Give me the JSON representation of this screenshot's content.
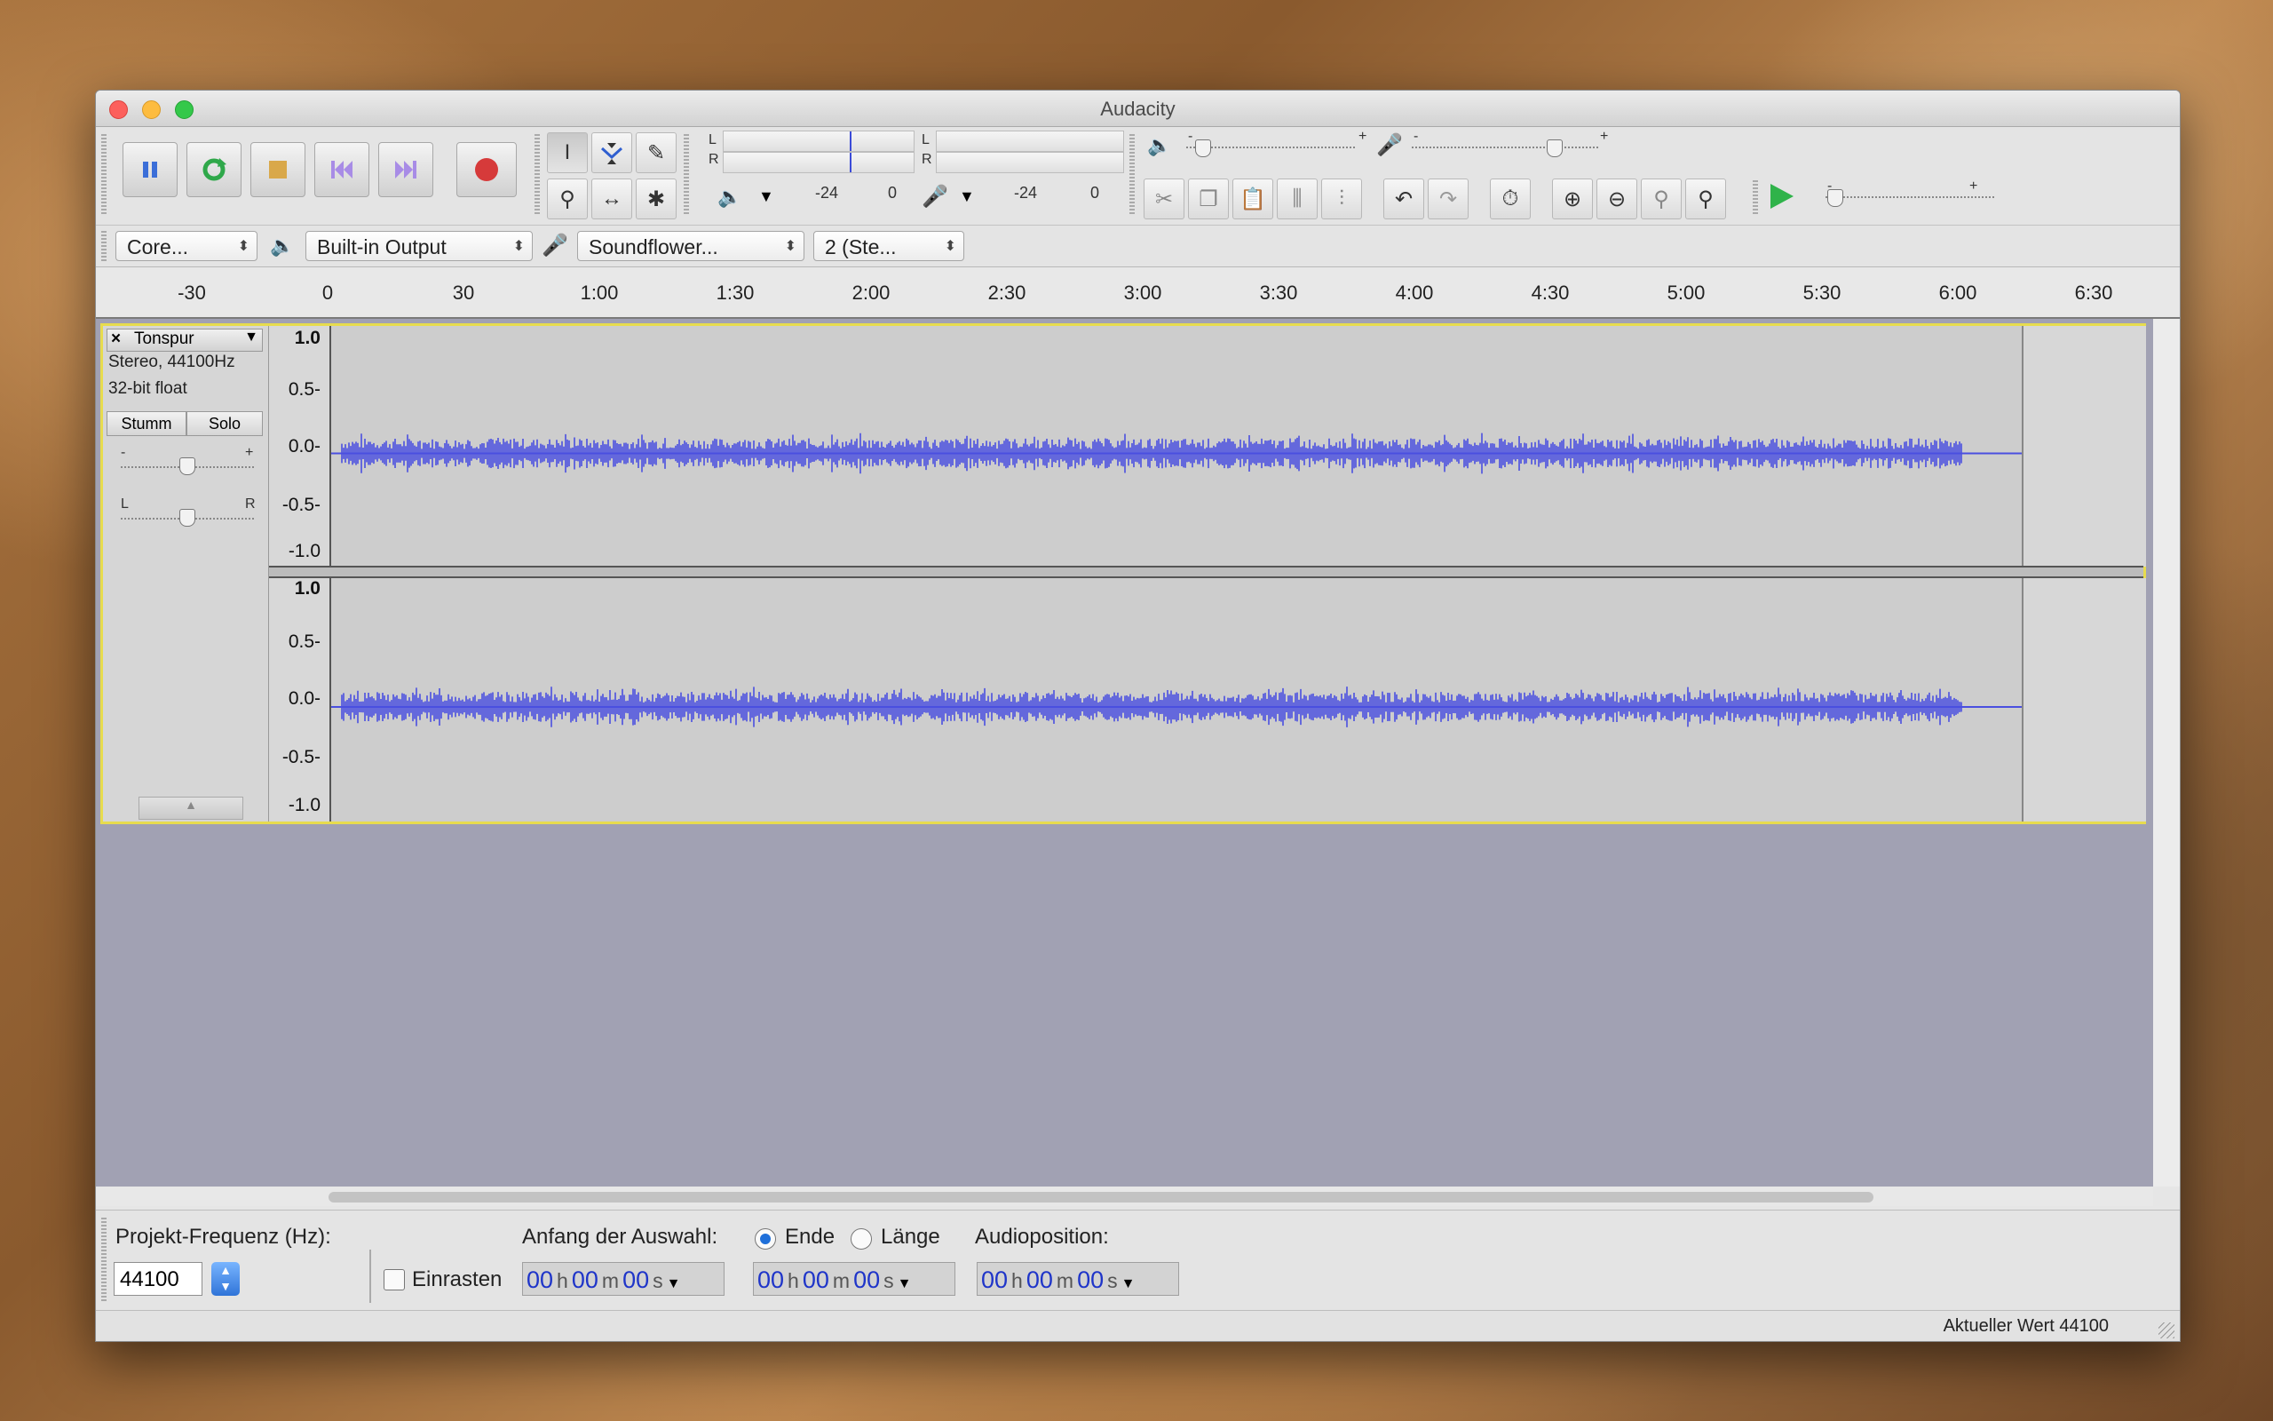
{
  "window": {
    "title": "Audacity"
  },
  "transport": {
    "pause": "pause-icon",
    "loop": "loop-icon",
    "stop": "stop-icon",
    "skip_start": "skip-start-icon",
    "skip_end": "skip-end-icon",
    "record": "record-icon"
  },
  "meters": {
    "play_label_l": "L",
    "play_label_r": "R",
    "rec_label_l": "L",
    "rec_label_r": "R",
    "tick_minus24_a": "-24",
    "tick_0_a": "0",
    "tick_minus24_b": "-24",
    "tick_0_b": "0"
  },
  "mixer": {
    "minus": "-",
    "plus": "+",
    "minus_b": "-",
    "plus_b": "+",
    "play_minus": "-",
    "play_plus": "+"
  },
  "devices": {
    "host": "Core...",
    "output": "Built-in Output",
    "input": "Soundflower...",
    "channels": "2 (Ste..."
  },
  "ruler": {
    "ticks": [
      "-30",
      "0",
      "30",
      "1:00",
      "1:30",
      "2:00",
      "2:30",
      "3:00",
      "3:30",
      "4:00",
      "4:30",
      "5:00",
      "5:30",
      "6:00",
      "6:30"
    ]
  },
  "track": {
    "close": "×",
    "name": "Tonspur",
    "format": "Stereo, 44100Hz",
    "bit_depth": "32-bit float",
    "mute": "Stumm",
    "solo": "Solo",
    "gain_minus": "-",
    "gain_plus": "+",
    "pan_left": "L",
    "pan_right": "R",
    "scale": [
      "1.0",
      "0.5-",
      "0.0-",
      "-0.5-",
      "-1.0"
    ],
    "wave_color": "#4a4fe0"
  },
  "selection": {
    "project_rate_label": "Projekt-Frequenz (Hz):",
    "project_rate_value": "44100",
    "snap_label": "Einrasten",
    "start_label": "Anfang der Auswahl:",
    "end_label": "Ende",
    "length_label": "Länge",
    "position_label": "Audioposition:",
    "h_unit": "h",
    "m_unit": "m",
    "s_unit": "s",
    "time_h": "00",
    "time_m": "00",
    "time_s": "00"
  },
  "status": {
    "text": "Aktueller Wert 44100"
  }
}
